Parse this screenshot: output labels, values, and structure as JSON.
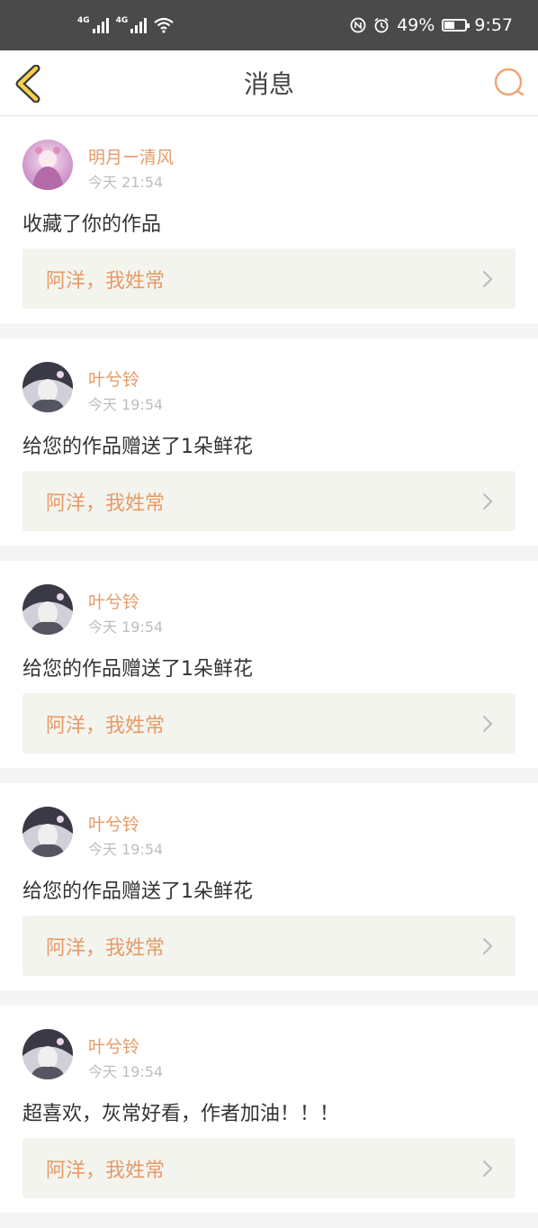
{
  "status": {
    "battery": "49%",
    "battery_level": 0.49,
    "time": "9:57",
    "signal_label": "4G",
    "icons": [
      "signal-icon",
      "signal-icon",
      "wifi-icon",
      "nfc-icon",
      "alarm-icon",
      "battery-icon"
    ]
  },
  "nav": {
    "title": "消息",
    "back_icon": "back-chevron-icon",
    "search_icon": "search-icon"
  },
  "colors": {
    "accent": "#e69a68",
    "back_icon_fill": "#f5d04a",
    "status_bar": "#4a4a4a"
  },
  "messages": [
    {
      "user": "明月ー清风",
      "time": "今天 21:54",
      "action": "收藏了你的作品",
      "work": "阿洋，我姓常"
    },
    {
      "user": "叶兮铃",
      "time": "今天 19:54",
      "action": "给您的作品赠送了1朵鲜花",
      "work": "阿洋，我姓常"
    },
    {
      "user": "叶兮铃",
      "time": "今天 19:54",
      "action": "给您的作品赠送了1朵鲜花",
      "work": "阿洋，我姓常"
    },
    {
      "user": "叶兮铃",
      "time": "今天 19:54",
      "action": "给您的作品赠送了1朵鲜花",
      "work": "阿洋，我姓常"
    },
    {
      "user": "叶兮铃",
      "time": "今天 19:54",
      "action": "超喜欢，灰常好看，作者加油！！！",
      "work": "阿洋，我姓常"
    }
  ]
}
